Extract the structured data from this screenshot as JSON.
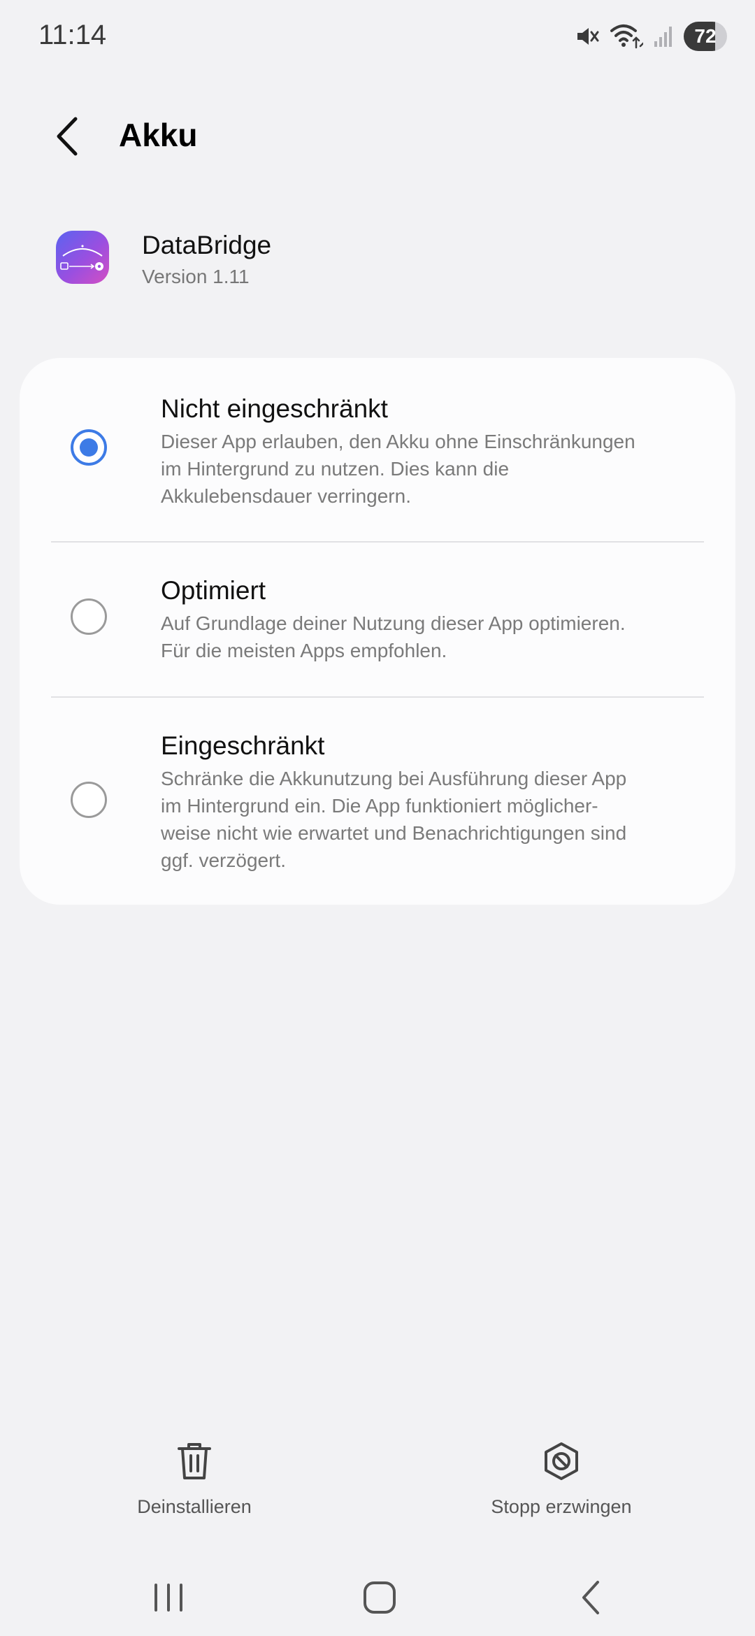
{
  "status_bar": {
    "time": "11:14",
    "battery_level": "72",
    "icons": [
      "mute-icon",
      "wifi-icon",
      "signal-icon",
      "battery-icon"
    ]
  },
  "header": {
    "title": "Akku",
    "back_icon": "chevron-left-icon"
  },
  "app": {
    "name": "DataBridge",
    "version": "Version 1.11"
  },
  "options": [
    {
      "title": "Nicht eingeschränkt",
      "desc_lines": [
        "Dieser App erlauben, den Akku ohne Einschränkungen",
        "im Hintergrund zu nutzen. Dies kann die",
        "Akkulebensdauer verringern."
      ],
      "selected": true
    },
    {
      "title": "Optimiert",
      "desc_lines": [
        "Auf Grundlage deiner Nutzung dieser App optimieren.",
        "Für die meisten Apps empfohlen."
      ],
      "selected": false
    },
    {
      "title": "Eingeschränkt",
      "desc_lines": [
        "Schränke die Akkunutzung bei Ausführung dieser App",
        "im Hintergrund ein. Die App funktioniert möglicher-",
        "weise nicht wie erwartet und Benachrichtigungen sind",
        "ggf. verzögert."
      ],
      "selected": false
    }
  ],
  "actions": {
    "uninstall_label": "Deinstallieren",
    "force_stop_label": "Stopp erzwingen"
  },
  "colors": {
    "accent": "#3d7be6",
    "background": "#f2f2f4",
    "card": "#fcfcfd"
  }
}
